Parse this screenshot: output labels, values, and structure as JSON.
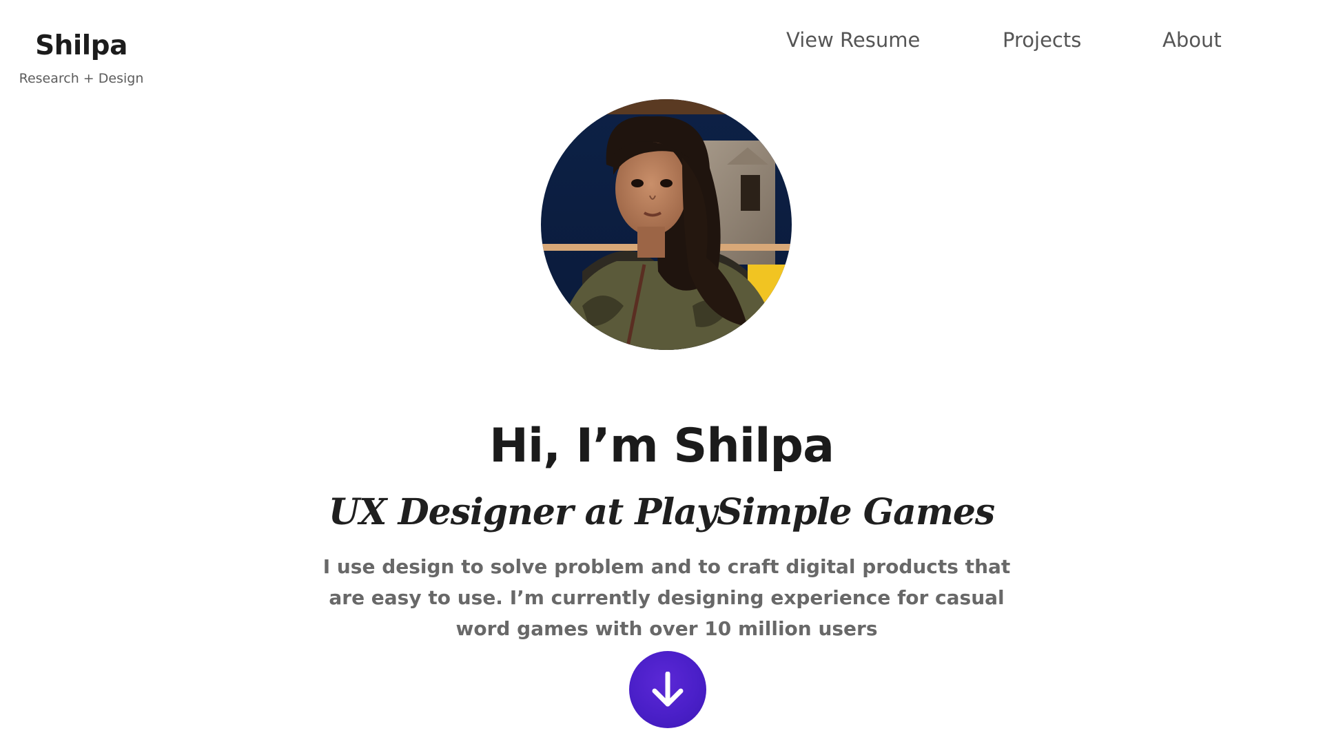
{
  "header": {
    "brand_name": "Shilpa",
    "brand_tagline": "Research + Design"
  },
  "nav": {
    "items": [
      {
        "label": "View Resume"
      },
      {
        "label": "Projects"
      },
      {
        "label": "About"
      }
    ]
  },
  "hero": {
    "title": "Hi, I’m Shilpa",
    "subtitle": "UX Designer at PlaySimple Games",
    "description": "I use design to solve problem and to craft digital products that are easy to use. I’m currently designing experience for casual word games with over 10 million users",
    "scroll_icon": "arrow-down-icon"
  },
  "colors": {
    "background": "#ffffff",
    "text_primary": "#1b1b1b",
    "text_secondary": "#686868",
    "nav_text": "#555555",
    "accent": "#4a1fc8"
  }
}
